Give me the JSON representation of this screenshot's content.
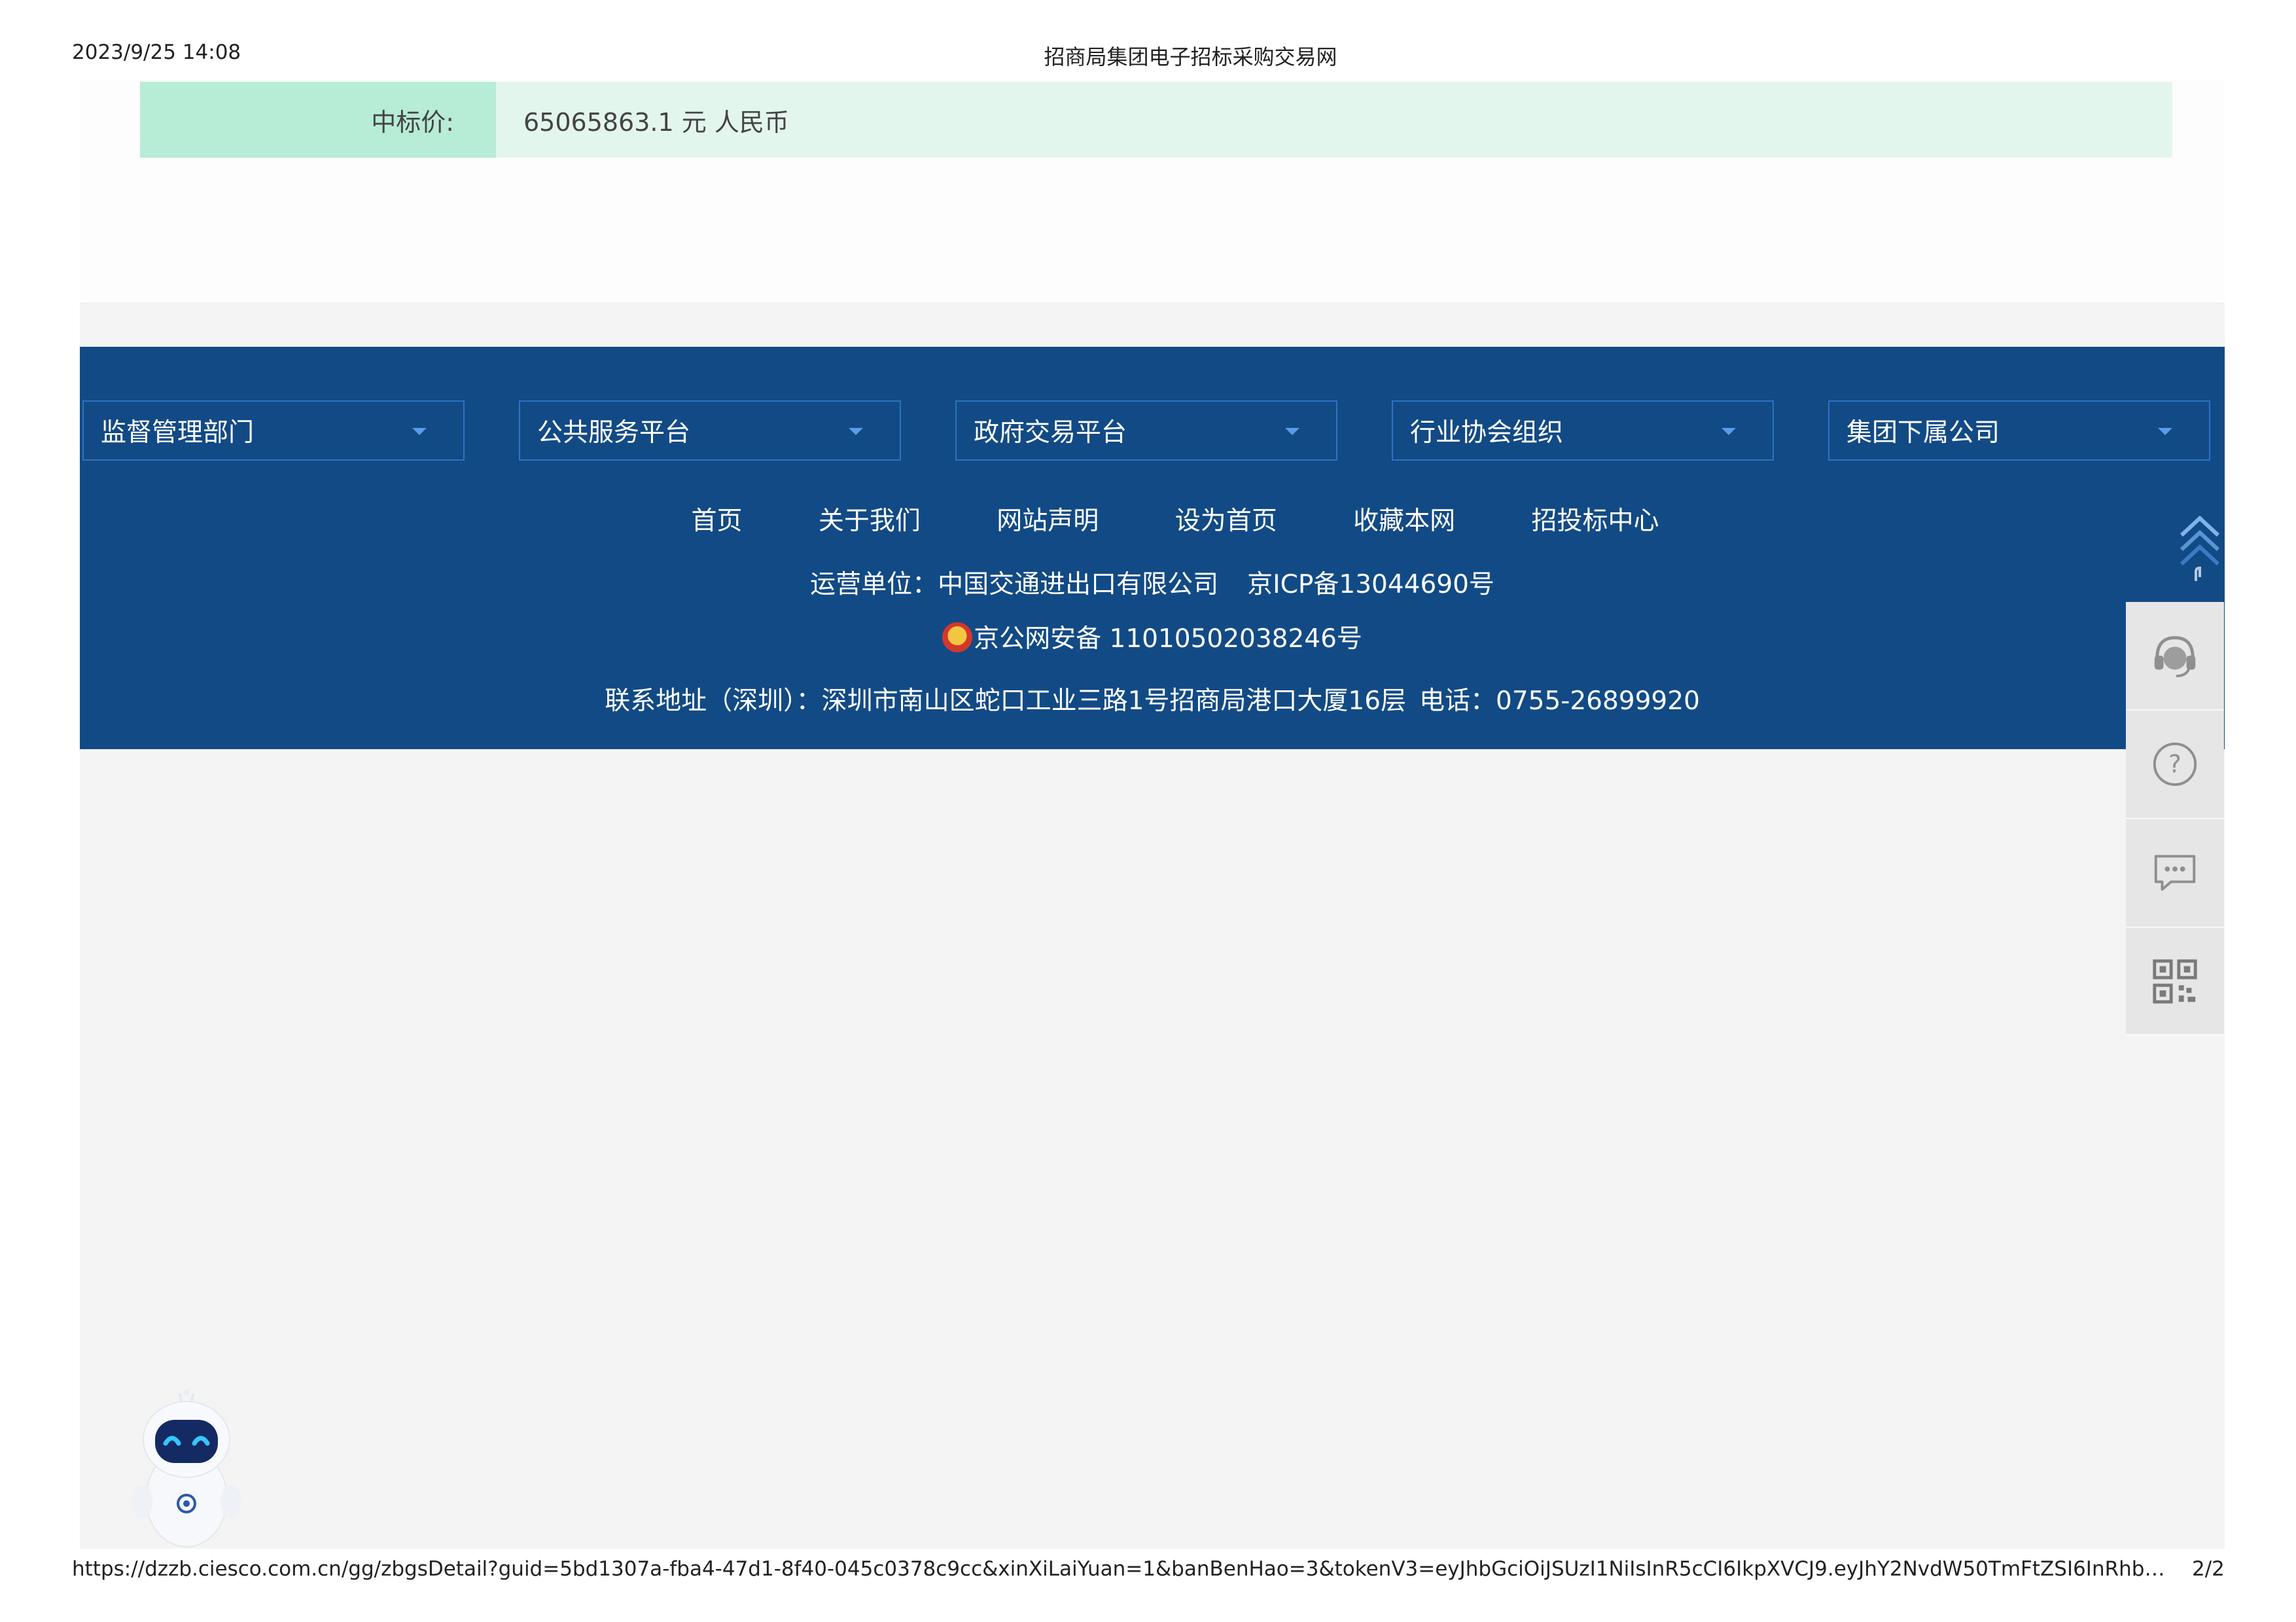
{
  "print_header": {
    "datetime": "2023/9/25 14:08",
    "title": "招商局集团电子招标采购交易网"
  },
  "bid_info": {
    "price_label": "中标价:",
    "price_value": "65065863.1 元 人民币"
  },
  "footer": {
    "dropdowns": [
      "监督管理部门",
      "公共服务平台",
      "政府交易平台",
      "行业协会组织",
      "集团下属公司"
    ],
    "links": [
      "首页",
      "关于我们",
      "网站声明",
      "设为首页",
      "收藏本网",
      "招投标中心"
    ],
    "operator": "运营单位：中国交通进出口有限公司",
    "icp": "京ICP备13044690号",
    "police_record": "京公网安备 11010502038246号",
    "address": "联系地址（深圳）：深圳市南山区蛇口工业三路1号招商局港口大厦16层",
    "phone": "电话：0755-26899920"
  },
  "side_toolbar": {
    "icons": [
      "customer-service-icon",
      "help-icon",
      "message-icon",
      "qr-code-icon"
    ]
  },
  "print_footer": {
    "url": "https://dzzb.ciesco.com.cn/gg/zbgsDetail?guid=5bd1307a-fba4-47d1-8f40-045c0378c9cc&xinXiLaiYuan=1&banBenHao=3&tokenV3=eyJhbGciOiJSUzI1NiIsInR5cCI6IkpXVCJ9.eyJhY2NvdW50TmFtZSI6InRhb3poZ…",
    "page_number": "2/2"
  },
  "colors": {
    "footer_bg": "#124a85",
    "price_label_bg": "#b7ecd7",
    "price_value_bg": "#e3f6ee",
    "dropdown_border": "#2f72c4"
  }
}
